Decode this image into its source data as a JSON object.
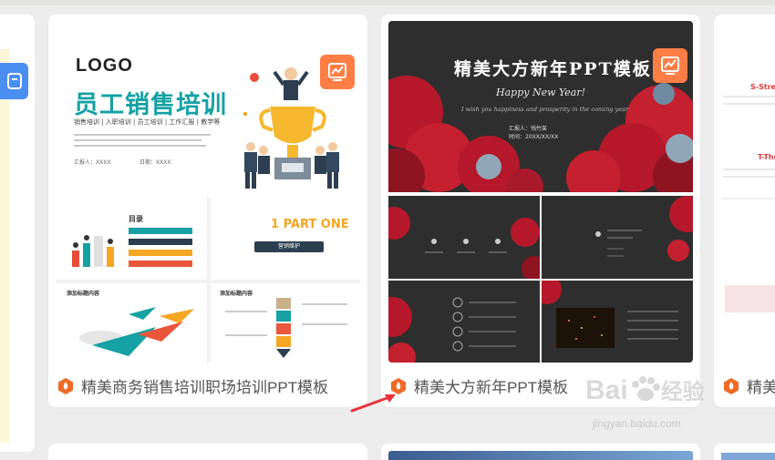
{
  "colors": {
    "accent": "#ff7e45",
    "teal": "#16a1a4",
    "blue": "#4a8ef2",
    "arrow": "#e8333c"
  },
  "left_panel": {
    "icon": "note-icon"
  },
  "cards": [
    {
      "title": "精美商务销售培训职场培训PPT模板",
      "badge_icon": "chart-trend-icon",
      "title_icon": "hexagon-fire-icon",
      "slide": {
        "logo": "LOGO",
        "title": "员工销售培训",
        "subtitle": "销售培训 | 入职培训 | 员工培训 | 工作汇报 | 教学等",
        "reporter": "汇报人：XXXX",
        "date": "日期：XXXX",
        "toc_title": "目录",
        "part_one": "1 PART ONE",
        "section_name": "营销维护",
        "add_title": "添加标题内容"
      }
    },
    {
      "title": "精美大方新年PPT模板",
      "badge_icon": "chart-trend-icon",
      "title_icon": "hexagon-fire-icon",
      "slide": {
        "title": "精美大方新年PPT模板",
        "greeting": "Happy New Year!",
        "wish": "I wish you happiness and prosperity in the coming year",
        "reporter": "汇报人：钱竹某",
        "date": "时间：20XX/XX/XX"
      }
    },
    {
      "title": "精美",
      "title_icon": "hexagon-fire-icon",
      "slide": {
        "heading_1": "S-Streng",
        "heading_2": "T-Thr"
      }
    }
  ],
  "watermark": {
    "brand": "Bai",
    "brand_cn": "经验",
    "url": "jingyan.baidu.com"
  }
}
